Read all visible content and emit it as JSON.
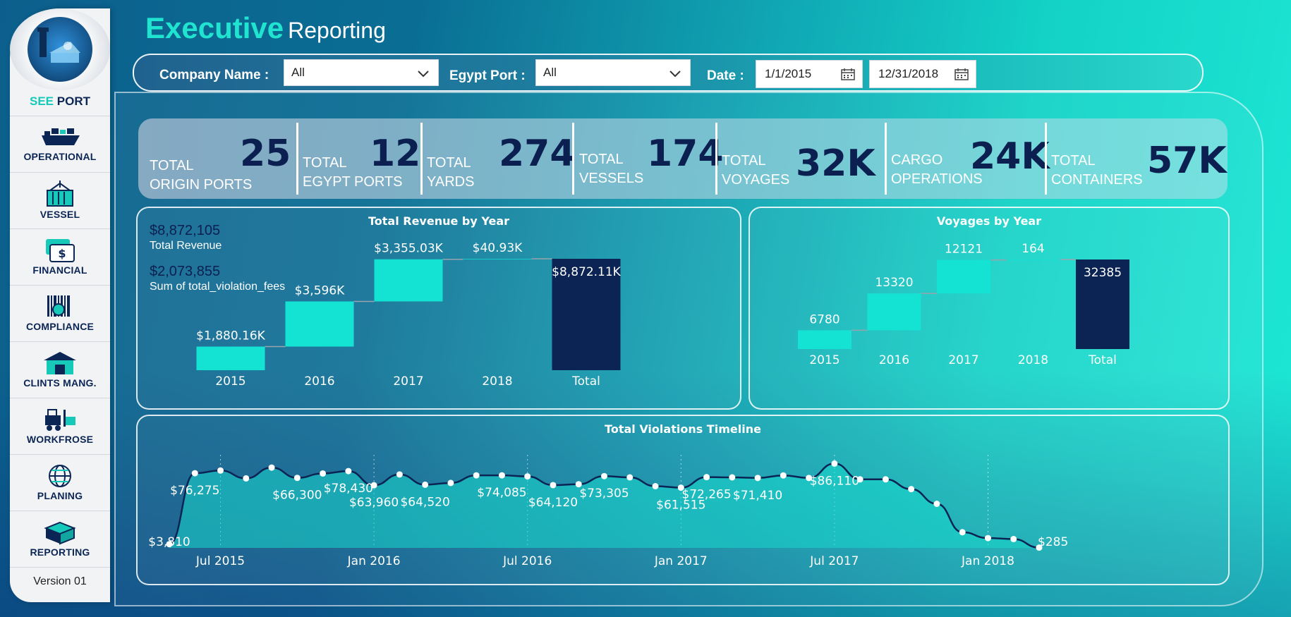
{
  "header": {
    "title_bold": "Executive",
    "title_rest": "Reporting"
  },
  "sidebar": {
    "brand_accent": "SEE",
    "brand_rest": "PORT",
    "version": "Version 01",
    "items": [
      {
        "label": "OPERATIONAL",
        "icon": "ship-icon"
      },
      {
        "label": "VESSEL",
        "icon": "container-icon"
      },
      {
        "label": "FINANCIAL",
        "icon": "money-icon"
      },
      {
        "label": "COMPLIANCE",
        "icon": "barcode-icon"
      },
      {
        "label": "CLINTS MANG.",
        "icon": "warehouse-icon"
      },
      {
        "label": "WORKFROSE",
        "icon": "forklift-icon"
      },
      {
        "label": "PLANING",
        "icon": "globe-icon"
      },
      {
        "label": "REPORTING",
        "icon": "box-icon"
      }
    ]
  },
  "filters": {
    "company_label": "Company Name :",
    "company_value": "All",
    "port_label": "Egypt Port :",
    "port_value": "All",
    "date_label": "Date :",
    "date_start": "1/1/2015",
    "date_end": "12/31/2018"
  },
  "kpis": [
    {
      "line1": "TOTAL",
      "line2": "ORIGIN PORTS",
      "value": "25"
    },
    {
      "line1": "TOTAL",
      "line2": "EGYPT PORTS",
      "value": "12"
    },
    {
      "line1": "TOTAL",
      "line2": "YARDS",
      "value": "274"
    },
    {
      "line1": "TOTAL",
      "line2": "VESSELS",
      "value": "174"
    },
    {
      "line1": "TOTAL",
      "line2": "VOYAGES",
      "value": "32K"
    },
    {
      "line1": "CARGO",
      "line2": "OPERATIONS",
      "value": "24K"
    },
    {
      "line1": "TOTAL",
      "line2": "CONTAINERS",
      "value": "57K"
    }
  ],
  "revenue_card": {
    "total_revenue_value": "$8,872,105",
    "total_revenue_label": "Total Revenue",
    "violation_value": "$2,073,855",
    "violation_label": "Sum of total_violation_fees"
  },
  "colors": {
    "bar": "#14e3d4",
    "total_bar": "#0b2454",
    "line": "#0b2454",
    "area": "#17d8cc"
  },
  "chart_data": [
    {
      "type": "bar",
      "subtype": "waterfall",
      "title": "Total Revenue by Year",
      "categories": [
        "2015",
        "2016",
        "2017",
        "2018",
        "Total"
      ],
      "values": [
        1880.16,
        3596,
        3355.03,
        40.93,
        8872.11
      ],
      "unit": "thousands USD",
      "data_labels": [
        "$1,880.16K",
        "$3,596K",
        "$3,355.03K",
        "$40.93K",
        "$8,872.11K"
      ]
    },
    {
      "type": "bar",
      "subtype": "waterfall",
      "title": "Voyages by Year",
      "categories": [
        "2015",
        "2016",
        "2017",
        "2018",
        "Total"
      ],
      "values": [
        6780,
        13320,
        12121,
        164,
        32385
      ],
      "data_labels": [
        "6780",
        "13320",
        "12121",
        "164",
        "32385"
      ]
    },
    {
      "type": "area",
      "title": "Total Violations Timeline",
      "x_ticks": [
        "Jul 2015",
        "Jan 2016",
        "Jul 2016",
        "Jan 2017",
        "Jul 2017",
        "Jan 2018"
      ],
      "x": [
        "2015-05",
        "2015-06",
        "2015-07",
        "2015-08",
        "2015-09",
        "2015-10",
        "2015-11",
        "2015-12",
        "2016-01",
        "2016-02",
        "2016-03",
        "2016-04",
        "2016-05",
        "2016-06",
        "2016-07",
        "2016-08",
        "2016-09",
        "2016-10",
        "2016-11",
        "2016-12",
        "2017-01",
        "2017-02",
        "2017-03",
        "2017-04",
        "2017-05",
        "2017-06",
        "2017-07",
        "2017-08",
        "2017-09",
        "2017-10",
        "2017-11",
        "2017-12",
        "2018-01",
        "2018-02",
        "2018-03"
      ],
      "values": [
        3810,
        76275,
        79000,
        71000,
        82000,
        71500,
        76000,
        78430,
        63960,
        75000,
        64520,
        66300,
        74085,
        74085,
        73000,
        64120,
        65000,
        73305,
        72000,
        63000,
        61515,
        72265,
        72000,
        71410,
        74000,
        71410,
        86110,
        70000,
        70000,
        60000,
        45000,
        16000,
        10000,
        9000,
        285
      ],
      "labels": [
        {
          "index": 0,
          "text": "$3,810"
        },
        {
          "index": 1,
          "text": "$76,275"
        },
        {
          "index": 5,
          "text": "$66,300"
        },
        {
          "index": 7,
          "text": "$78,430"
        },
        {
          "index": 8,
          "text": "$63,960"
        },
        {
          "index": 10,
          "text": "$64,520"
        },
        {
          "index": 13,
          "text": "$74,085"
        },
        {
          "index": 15,
          "text": "$64,120"
        },
        {
          "index": 17,
          "text": "$73,305"
        },
        {
          "index": 20,
          "text": "$61,515"
        },
        {
          "index": 21,
          "text": "$72,265"
        },
        {
          "index": 23,
          "text": "$71,410"
        },
        {
          "index": 26,
          "text": "$86,110"
        },
        {
          "index": 34,
          "text": "$285"
        }
      ]
    }
  ]
}
